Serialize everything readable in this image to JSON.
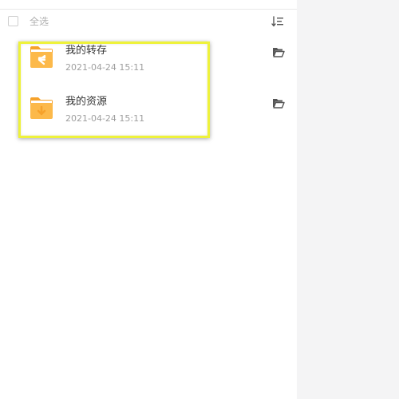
{
  "header": {
    "select_all_label": "全选",
    "select_all_checked": false,
    "sort_icon": "sort-list-icon"
  },
  "files": [
    {
      "name": "我的转存",
      "time": "2021-04-24 15:11",
      "icon": "folder-transfer-icon",
      "action_icon": "open-folder-icon"
    },
    {
      "name": "我的资源",
      "time": "2021-04-24 15:11",
      "icon": "folder-download-icon",
      "action_icon": "open-folder-icon"
    }
  ],
  "colors": {
    "folder_body": "#fcb94a",
    "folder_back": "#f6a22b",
    "highlight": "#eef23a",
    "right_panel_bg": "#f4f4f5",
    "icon_gray": "#555555"
  }
}
